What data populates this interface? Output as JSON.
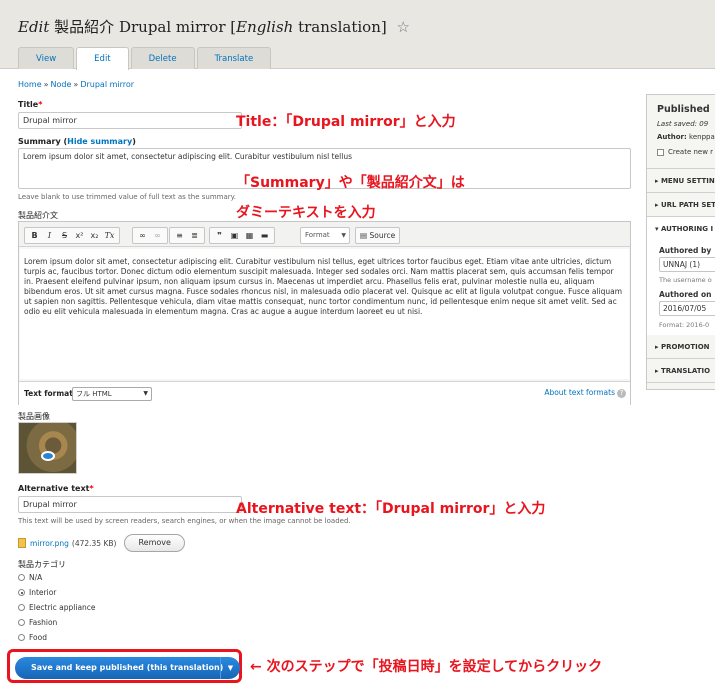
{
  "header": {
    "title_edit": "Edit",
    "title_type": "製品紹介",
    "title_node": "Drupal mirror",
    "title_bracket_open": "[",
    "title_lang": "English",
    "title_translation": "translation]",
    "star": "☆"
  },
  "tabs": [
    {
      "label": "View",
      "active": false
    },
    {
      "label": "Edit",
      "active": true
    },
    {
      "label": "Delete",
      "active": false
    },
    {
      "label": "Translate",
      "active": false
    }
  ],
  "breadcrumb": {
    "home": "Home",
    "node": "Node",
    "current": "Drupal mirror",
    "separator": "»"
  },
  "form": {
    "title_label": "Title",
    "title_value": "Drupal mirror",
    "summary_label": "Summary",
    "hide_summary": "Hide summary",
    "summary_value": "Lorem ipsum dolor sit amet, consectetur adipiscing elit. Curabitur vestibulum nisl tellus",
    "summary_desc": "Leave blank to use trimmed value of full text as the summary.",
    "body_label": "製品紹介文",
    "body_text": "Lorem ipsum dolor sit amet, consectetur adipiscing elit. Curabitur vestibulum nisl tellus, eget ultrices tortor faucibus eget. Etiam vitae ante ultricies, dictum turpis ac, faucibus tortor. Donec dictum odio elementum suscipit malesuada. Integer sed sodales orci. Nam mattis placerat sem, quis accumsan felis tempor in. Praesent eleifend pulvinar ipsum, non aliquam ipsum cursus in. Maecenas ut imperdiet arcu. Phasellus felis erat, pulvinar molestie nulla eu, aliquam bibendum eros. Ut sit amet cursus magna. Fusce sodales rhoncus nisl, in malesuada odio placerat vel. Quisque ac elit at ligula volutpat congue. Fusce aliquam ut sapien non sagittis. Pellentesque vehicula, diam vitae mattis consequat, nunc tortor condimentum nunc, id pellentesque enim neque sit amet velit. Sed ac odio eu elit vehicula malesuada in elementum magna. Cras ac augue a augue interdum laoreet eu ut nisi.",
    "toolbar": {
      "bold": "B",
      "italic": "I",
      "strike": "S",
      "superscript": "x²",
      "subscript": "x₂",
      "clear": "Tx",
      "format": "Format",
      "source": "Source"
    },
    "text_format_label": "Text format",
    "text_format_value": "フル HTML",
    "about_formats": "About text formats",
    "image_label": "製品画像",
    "alt_label": "Alternative text",
    "alt_value": "Drupal mirror",
    "alt_desc": "This text will be used by screen readers, search engines, or when the image cannot be loaded.",
    "file_name": "mirror.png",
    "file_size": "(472.35 KB)",
    "remove_button": "Remove",
    "category_label": "製品カテゴリ",
    "categories": [
      {
        "label": "N/A",
        "selected": false
      },
      {
        "label": "Interior",
        "selected": true
      },
      {
        "label": "Electric appliance",
        "selected": false
      },
      {
        "label": "Fashion",
        "selected": false
      },
      {
        "label": "Food",
        "selected": false
      }
    ],
    "save_button": "Save and keep published (this translation)"
  },
  "sidebar": {
    "status": "Published",
    "last_saved_label": "Last saved:",
    "last_saved_value": "09",
    "author_label": "Author:",
    "author_value": "kenppa",
    "create_new": "Create new r",
    "sections": {
      "menu": "MENU SETTIN",
      "url": "URL PATH SET",
      "authoring": "AUTHORING I",
      "promotion": "PROMOTION",
      "translation": "TRANSLATIO"
    },
    "authored_by_label": "Authored by",
    "authored_by_value": "UNNAJ (1)",
    "authored_by_desc": "The username o",
    "authored_on_label": "Authored on",
    "authored_on_value": "2016/07/05",
    "authored_on_desc": "Format: 2016-0"
  },
  "annotations": {
    "title_note": "Title：「Drupal mirror」と入力",
    "summary_note_1": "「Summary」や「製品紹介文」は",
    "summary_note_2": "ダミーテキストを入力",
    "alt_note": "Alternative text：「Drupal mirror」と入力",
    "save_note": "← 次のステップで「投稿日時」を設定してからクリック"
  },
  "colors": {
    "accent": "#0074bd",
    "annotation": "#e8141e",
    "button": "#1d6fc2"
  }
}
